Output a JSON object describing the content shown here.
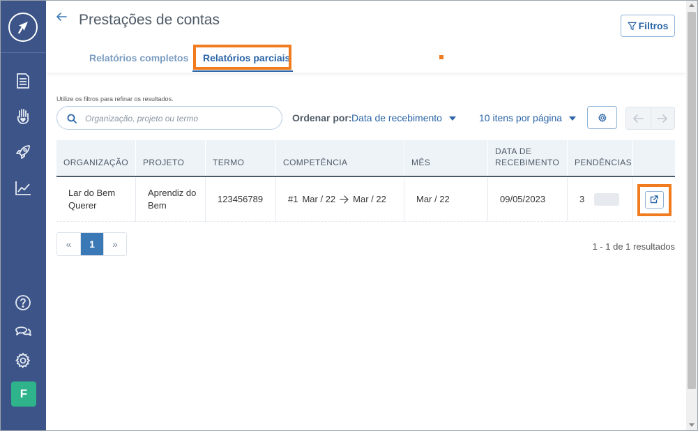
{
  "app": {
    "avatar_initial": "F",
    "accent_color": "#2a64a6",
    "sidebar_color": "#3c5488",
    "highlight_color": "#f07c1f",
    "avatar_color": "#2eb38a"
  },
  "sidebar": {
    "items": [
      {
        "icon": "document-icon"
      },
      {
        "icon": "hand-heart-icon"
      },
      {
        "icon": "rocket-icon"
      },
      {
        "icon": "chart-icon"
      }
    ],
    "bottom_items": [
      {
        "icon": "help-icon"
      },
      {
        "icon": "chat-icon"
      },
      {
        "icon": "gear-icon"
      }
    ]
  },
  "header": {
    "title": "Prestações de contas",
    "filters_label": "Filtros",
    "tabs": [
      {
        "label": "Relatórios completos",
        "active": false
      },
      {
        "label": "Relatórios parciais",
        "active": true
      }
    ]
  },
  "toolbar": {
    "hint": "Utilize os filtros para refinar os resultados.",
    "search_placeholder": "Organização, projeto ou termo",
    "order_label": "Ordenar por:",
    "order_value": "Data de recebimento",
    "per_page": "10 itens por página"
  },
  "table": {
    "columns": [
      "ORGANIZAÇÃO",
      "PROJETO",
      "TERMO",
      "COMPETÊNCIA",
      "MÊS",
      "DATA DE RECEBIMENTO",
      "PENDÊNCIAS",
      ""
    ],
    "rows": [
      {
        "organizacao": "Lar do Bem Querer",
        "projeto": "Aprendiz do Bem",
        "termo": "123456789",
        "competencia_num": "#1",
        "competencia_start": "Mar / 22",
        "competencia_end": "Mar / 22",
        "mes": "Mar / 22",
        "data_recebimento": "09/05/2023",
        "pendencias": "3"
      }
    ]
  },
  "pagination": {
    "prev": "«",
    "current": "1",
    "next": "»",
    "results": "1 - 1 de 1 resultados"
  }
}
